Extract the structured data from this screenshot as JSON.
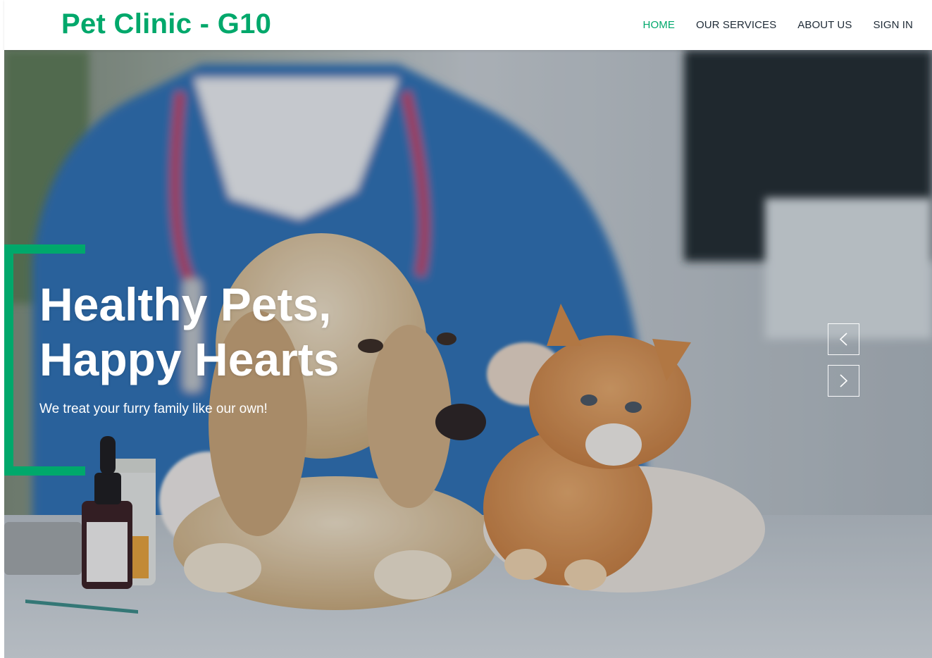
{
  "brand": {
    "name": "Pet Clinic - G10",
    "color": "#00a86b"
  },
  "nav": {
    "items": [
      {
        "label": "HOME",
        "active": true
      },
      {
        "label": "OUR SERVICES",
        "active": false
      },
      {
        "label": "ABOUT US",
        "active": false
      },
      {
        "label": "SIGN IN",
        "active": false
      }
    ]
  },
  "hero": {
    "title_line1": "Healthy Pets,",
    "title_line2": "Happy Hearts",
    "subtitle": "We treat your furry family like our own!",
    "background": "vet-with-puppy-and-kitten-photo",
    "prev_icon": "chevron-left-icon",
    "next_icon": "chevron-right-icon",
    "accent": "#00a86b"
  }
}
